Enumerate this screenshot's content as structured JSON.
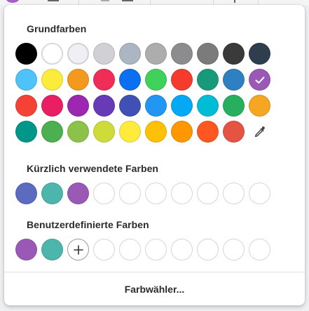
{
  "sections": {
    "basic": {
      "title": "Grundfarben"
    },
    "recent": {
      "title": "Kürzlich verwendete Farben"
    },
    "custom": {
      "title": "Benutzerdefinierte Farben"
    }
  },
  "basic_colors": [
    [
      "#000000",
      "#ffffff",
      "#efeff5",
      "#d0d0d5",
      "#acb6c2",
      "#adadad",
      "#8c8c8e",
      "#7b7b7b",
      "#3a3a3a",
      "#2f3e4e"
    ],
    [
      "#4fc3f7",
      "#fbeb3b",
      "#f39a1e",
      "#ef2d56",
      "#0a6ff0",
      "#3fd15a",
      "#f53b2c",
      "#17997a",
      "#2f7fc3",
      "#9b59b6"
    ],
    [
      "#f44336",
      "#e91e63",
      "#9c27b0",
      "#673ab7",
      "#3f51b5",
      "#2196f3",
      "#03a9f4",
      "#00bcd4",
      "#28ae5f",
      "#f5a623"
    ],
    [
      "#009688",
      "#4caf50",
      "#8bc34a",
      "#cddc39",
      "#ffeb3b",
      "#ffc107",
      "#ff9800",
      "#ff5722",
      "#e55343"
    ]
  ],
  "selected_basic_color": "#9b59b6",
  "light_colors": [
    "#ffffff",
    "#efeff5"
  ],
  "recent_colors": [
    "#5c6bc0",
    "#4db6ac",
    "#9b59b6"
  ],
  "custom_colors": [
    "#9b59b6",
    "#4db6ac"
  ],
  "empty_slot_count": 7,
  "footer": {
    "label": "Farbwähler..."
  },
  "icons": {
    "eyedropper": "eyedropper-icon",
    "add": "plus-icon",
    "check": "checkmark-icon"
  }
}
